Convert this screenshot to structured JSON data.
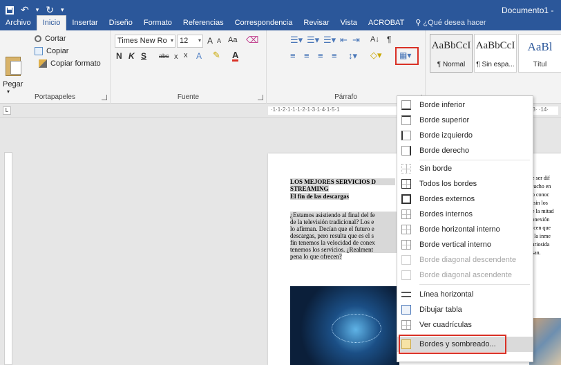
{
  "window": {
    "title": "Documento1 -"
  },
  "tabs": [
    {
      "label": "Archivo"
    },
    {
      "label": "Inicio"
    },
    {
      "label": "Insertar"
    },
    {
      "label": "Diseño"
    },
    {
      "label": "Formato"
    },
    {
      "label": "Referencias"
    },
    {
      "label": "Correspondencia"
    },
    {
      "label": "Revisar"
    },
    {
      "label": "Vista"
    },
    {
      "label": "ACROBAT"
    }
  ],
  "tell_me": "¿Qué desea hacer",
  "clipboard": {
    "paste": "Pegar",
    "cut": "Cortar",
    "copy": "Copiar",
    "format_painter": "Copiar formato",
    "group_label": "Portapapeles"
  },
  "font": {
    "name": "Times New Ro",
    "size": "12",
    "grow": "A",
    "shrink": "A",
    "case": "Aa",
    "bold": "N",
    "italic": "K",
    "underline": "S",
    "strike": "abc",
    "subscript": "x",
    "superscript": "x",
    "color_a": "A",
    "group_label": "Fuente"
  },
  "paragraph": {
    "group_label": "Párrafo",
    "sort": "A↓",
    "pilcrow": "¶"
  },
  "styles": [
    {
      "sample": "AaBbCcI",
      "name": "¶ Normal"
    },
    {
      "sample": "AaBbCcI",
      "name": "¶ Sin espa..."
    },
    {
      "sample": "AaBl",
      "name": "Títul"
    }
  ],
  "ruler": {
    "scale": "·1·1·2·1·1·1·2·1·3·1·4·1·5·1",
    "right_scale": "13· ·14·"
  },
  "document": {
    "heading1": "LOS MEJORES SERVICIOS D",
    "heading2": "STREAMING",
    "subheading": "El fin de las descargas",
    "body_lines": [
      "¿Estamos asistiendo al final del fe",
      "de la televisión tradicional? Los e",
      "lo afirman. Decían que el futuro e",
      "descargas, pero resulta que es el s",
      "fin tenemos la velocidad de conex",
      "tenemos los servicios. ¿Realment",
      "pena lo que ofrecen?"
    ],
    "right_lines": [
      "de ser dif",
      "mucho en",
      "no conoc",
      "t, sin los",
      "de la mitad",
      "conexión",
      "dicen que",
      "s, la inme",
      "curiosida",
      "usan."
    ]
  },
  "borders_menu": {
    "items": [
      {
        "label": "Borde inferior",
        "disabled": false
      },
      {
        "label": "Borde superior",
        "disabled": false
      },
      {
        "label": "Borde izquierdo",
        "disabled": false
      },
      {
        "label": "Borde derecho",
        "disabled": false
      },
      {
        "label": "Sin borde",
        "disabled": false
      },
      {
        "label": "Todos los bordes",
        "disabled": false
      },
      {
        "label": "Bordes externos",
        "disabled": false
      },
      {
        "label": "Bordes internos",
        "disabled": false
      },
      {
        "label": "Borde horizontal interno",
        "disabled": false
      },
      {
        "label": "Borde vertical interno",
        "disabled": false
      },
      {
        "label": "Borde diagonal descendente",
        "disabled": true
      },
      {
        "label": "Borde diagonal ascendente",
        "disabled": true
      },
      {
        "label": "Línea horizontal",
        "disabled": false
      },
      {
        "label": "Dibujar tabla",
        "disabled": false
      },
      {
        "label": "Ver cuadrículas",
        "disabled": false
      },
      {
        "label": "Bordes y sombreado...",
        "disabled": false
      }
    ]
  },
  "colors": {
    "brand": "#2b579a",
    "highlight": "#d93025"
  }
}
